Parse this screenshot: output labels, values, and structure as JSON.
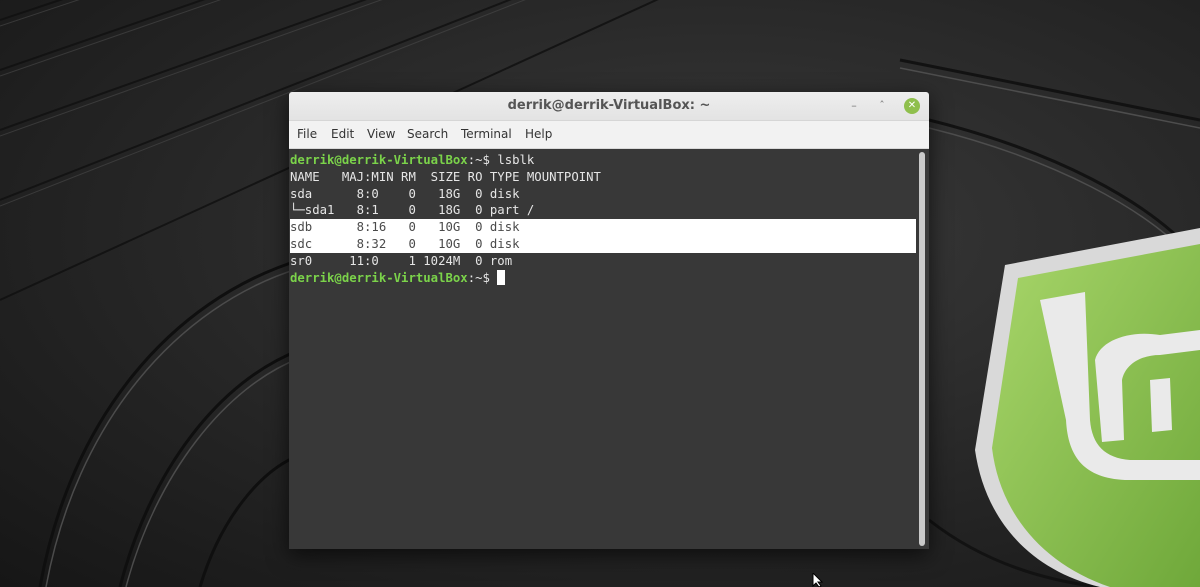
{
  "window": {
    "title": "derrik@derrik-VirtualBox: ~",
    "minimize_glyph": "–",
    "maximize_glyph": "ˆ",
    "close_glyph": "✕"
  },
  "menu": [
    {
      "label": "File"
    },
    {
      "label": "Edit"
    },
    {
      "label": "View"
    },
    {
      "label": "Search"
    },
    {
      "label": "Terminal"
    },
    {
      "label": "Help"
    }
  ],
  "terminal": {
    "prompt_user": "derrik@derrik-VirtualBox",
    "prompt_path": ":~$ ",
    "command": "lsblk",
    "header": "NAME   MAJ:MIN RM  SIZE RO TYPE MOUNTPOINT",
    "rows": [
      {
        "text": "sda      8:0    0   18G  0 disk ",
        "selected": false
      },
      {
        "text": "└─sda1   8:1    0   18G  0 part /",
        "selected": false
      },
      {
        "text": "sdb      8:16   0   10G  0 disk                                                          ",
        "selected": true
      },
      {
        "text": "sdc      8:32   0   10G  0 disk                                                          ",
        "selected": true
      },
      {
        "text": "sr0     11:0    1 1024M  0 rom  ",
        "selected": false
      }
    ]
  },
  "colors": {
    "prompt_green": "#7bd34a",
    "terminal_bg": "#383838",
    "mint_green": "#8fbf4d"
  },
  "icons": {
    "close": "close-icon",
    "minimize": "minimize-icon",
    "maximize": "maximize-icon",
    "logo": "linux-mint-logo-icon",
    "pointer": "mouse-pointer-icon"
  }
}
